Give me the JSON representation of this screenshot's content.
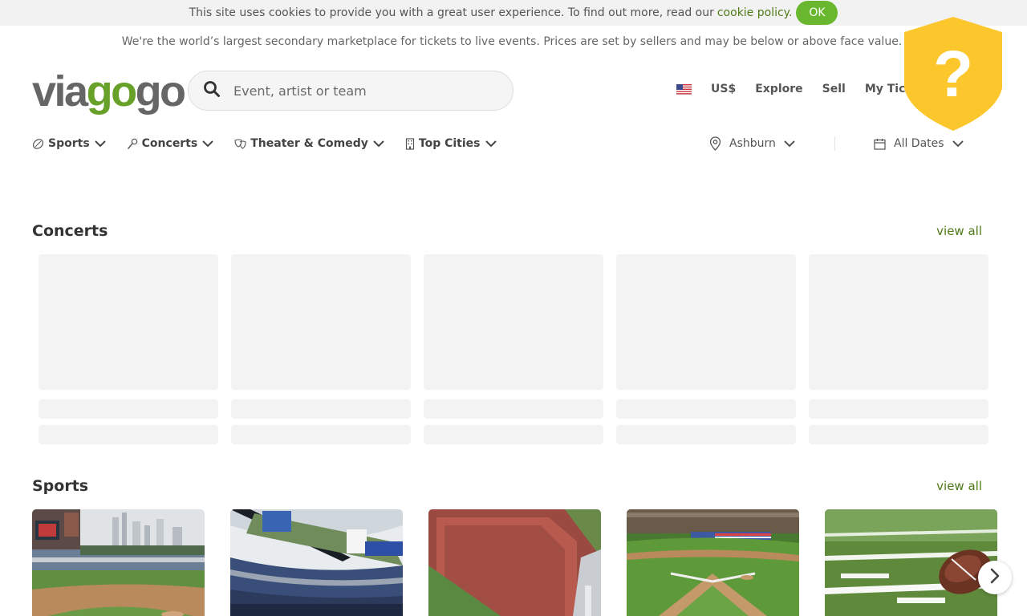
{
  "cookie": {
    "message": "This site uses cookies to provide you with a great user experience. To find out more, read our",
    "link_text": "cookie policy.",
    "ok_label": "OK"
  },
  "disclaimer": "We're the world’s largest secondary marketplace for tickets to live events. Prices are set by sellers and may be below or above face value.",
  "logo": {
    "part1": "via",
    "part2": "go",
    "part3": "go"
  },
  "search": {
    "placeholder": "Event, artist or team",
    "value": ""
  },
  "topnav": {
    "currency": "US$",
    "explore": "Explore",
    "sell": "Sell",
    "my_tickets": "My Tickets"
  },
  "categories": [
    {
      "label": "Sports",
      "icon": "ball-icon"
    },
    {
      "label": "Concerts",
      "icon": "microphone-icon"
    },
    {
      "label": "Theater & Comedy",
      "icon": "masks-icon"
    },
    {
      "label": "Top Cities",
      "icon": "building-icon"
    }
  ],
  "filters": {
    "location": "Ashburn",
    "dates": "All Dates"
  },
  "sections": {
    "concerts": {
      "title": "Concerts",
      "view_all": "view all"
    },
    "sports": {
      "title": "Sports",
      "view_all": "view all"
    }
  },
  "colors": {
    "accent_green": "#68b72f",
    "link_green": "#4e7a18",
    "shield_yellow": "#fcc72c"
  },
  "icons": [
    "search-icon",
    "us-flag-icon",
    "help-shield-icon",
    "location-pin-icon",
    "calendar-icon",
    "chevron-down-icon",
    "chevron-right-icon"
  ]
}
